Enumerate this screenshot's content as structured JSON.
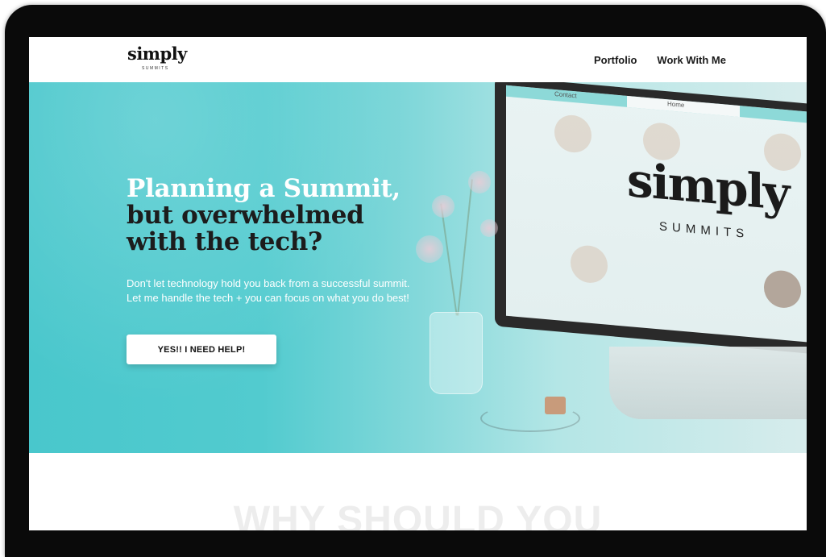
{
  "header": {
    "logo_text": "simply",
    "logo_subtext": "SUMMITS",
    "nav": [
      {
        "label": "Portfolio"
      },
      {
        "label": "Work With Me"
      }
    ]
  },
  "hero": {
    "title_highlight": "Planning a Summit,",
    "title_line2": "but overwhelmed",
    "title_line3": "with the tech?",
    "description": "Don't let technology hold you back from a successful summit. Let me handle the tech + you can focus on what you do best!",
    "cta_label": "YES!! I NEED HELP!",
    "colors": {
      "accent": "#52cbcf",
      "highlight_text": "#ffffff",
      "title_text": "#1c1c1c"
    }
  },
  "hero_image": {
    "screen_tabs": [
      "Contact",
      "Home"
    ],
    "brand_text": "simply",
    "brand_subtext": "SUMMITS"
  },
  "next_section": {
    "heading": "WHY SHOULD YOU"
  }
}
